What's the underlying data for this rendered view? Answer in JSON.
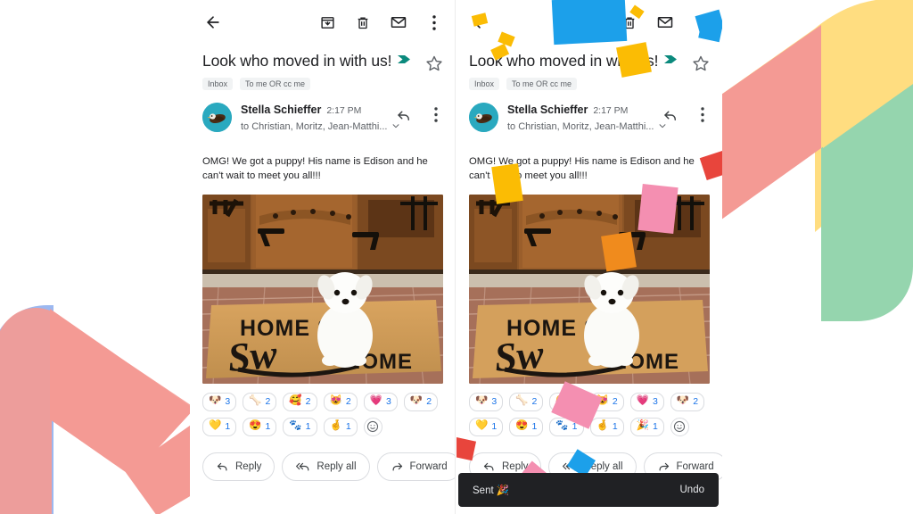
{
  "app": {
    "title": "Gmail email detail",
    "accent_teal": "#0b8a7d",
    "accent_blue": "#1a73e8",
    "snackbar_bg": "#202124"
  },
  "toolbar": {
    "back_icon": "arrow-back-icon",
    "archive_icon": "archive-icon",
    "delete_icon": "trash-icon",
    "mark_unread_icon": "envelope-icon",
    "overflow_icon": "more-vert-icon"
  },
  "email": {
    "subject": "Look who moved in with us!",
    "subject_badge_icon": "important-marker-icon",
    "labels": [
      "Inbox",
      "To me OR cc me"
    ],
    "star_icon": "star-outline-icon",
    "sender_name": "Stella Schieffer",
    "time": "2:17 PM",
    "recipients": "to Christian, Moritz, Jean-Matthi...",
    "expand_icon": "chevron-down-icon",
    "reply_icon": "reply-icon",
    "overflow_icon": "more-vert-icon",
    "body": "OMG! We got a puppy! His name is Edison and he can't wait to meet you all!!!",
    "photo_alt": "White Maltese puppy sitting on a HOME SWEET HOME doormat in front of a wooden door",
    "photo_text_top": "HOME SWEET",
    "photo_text_script": "Sweet",
    "photo_text_bottom": "HOME"
  },
  "reactions_before": {
    "row1": [
      {
        "emoji": "🐶",
        "name": "dog-face",
        "count": "3"
      },
      {
        "emoji": "🦴",
        "name": "bone",
        "count": "2"
      },
      {
        "emoji": "🥰",
        "name": "smiling-face-with-hearts",
        "count": "2"
      },
      {
        "emoji": "😻",
        "name": "heart-eyes-cat",
        "count": "2"
      },
      {
        "emoji": "💗",
        "name": "growing-heart",
        "count": "3"
      },
      {
        "emoji": "🐶",
        "name": "dog-running",
        "count": "2"
      }
    ],
    "row2": [
      {
        "emoji": "💛",
        "name": "yellow-heart-box",
        "count": "1"
      },
      {
        "emoji": "😍",
        "name": "heart-eyes",
        "count": "1"
      },
      {
        "emoji": "🐾",
        "name": "paw-prints",
        "count": "1"
      },
      {
        "emoji": "🤞",
        "name": "crossed-fingers",
        "count": "1"
      }
    ],
    "add_icon": "add-reaction-icon"
  },
  "reactions_after": {
    "row1": [
      {
        "emoji": "🐶",
        "name": "dog-face",
        "count": "3"
      },
      {
        "emoji": "🦴",
        "name": "bone",
        "count": "2"
      },
      {
        "emoji": "🥰",
        "name": "smiling-face-with-hearts",
        "count": "2"
      },
      {
        "emoji": "😻",
        "name": "heart-eyes-cat",
        "count": "2"
      },
      {
        "emoji": "💗",
        "name": "growing-heart",
        "count": "3"
      },
      {
        "emoji": "🐶",
        "name": "dog-running",
        "count": "2"
      }
    ],
    "row2": [
      {
        "emoji": "💛",
        "name": "yellow-heart-box",
        "count": "1"
      },
      {
        "emoji": "😍",
        "name": "heart-eyes",
        "count": "1"
      },
      {
        "emoji": "🐾",
        "name": "paw-prints",
        "count": "1"
      },
      {
        "emoji": "🤞",
        "name": "crossed-fingers",
        "count": "1"
      },
      {
        "emoji": "🎉",
        "name": "party-popper",
        "count": "1"
      }
    ],
    "add_icon": "add-reaction-icon"
  },
  "actions": {
    "reply": "Reply",
    "reply_all": "Reply all",
    "forward": "Forward",
    "emoji_icon": "add-reaction-icon"
  },
  "snackbar": {
    "message": "Sent 🎉",
    "action": "Undo"
  },
  "decorations": {
    "left_mark": "gmail-m-logo-pink-blue",
    "right_mark": "gmail-m-logo-yellow-green-red",
    "confetti": "confetti-burst"
  }
}
